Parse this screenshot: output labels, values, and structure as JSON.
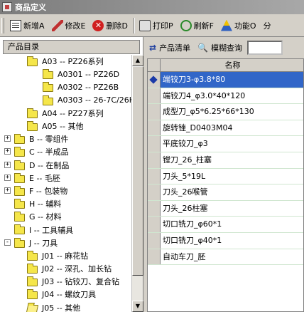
{
  "window": {
    "title": "商品定义"
  },
  "toolbar": {
    "buttons": [
      {
        "label": "新增A",
        "icon": "new-doc-icon"
      },
      {
        "label": "修改E",
        "icon": "edit-icon"
      },
      {
        "label": "删除D",
        "icon": "delete-icon"
      },
      {
        "label": "打印P",
        "icon": "print-icon"
      },
      {
        "label": "刷新F",
        "icon": "refresh-icon"
      },
      {
        "label": "功能O",
        "icon": "function-icon"
      },
      {
        "label": "分",
        "icon": ""
      }
    ]
  },
  "left_panel": {
    "header": "产品目录",
    "tree": [
      {
        "label": "A03 -- PZ26系列",
        "level": 1,
        "expander": "",
        "open": false
      },
      {
        "label": "A0301 -- PZ26D",
        "level": 2,
        "expander": "",
        "open": false
      },
      {
        "label": "A0302 -- PZ26B",
        "level": 2,
        "expander": "",
        "open": false
      },
      {
        "label": "A0303 -- 26-7C/26H",
        "level": 2,
        "expander": "",
        "open": false
      },
      {
        "label": "A04 -- PZ27系列",
        "level": 1,
        "expander": "",
        "open": false
      },
      {
        "label": "A05 -- 其他",
        "level": 1,
        "expander": "",
        "open": false
      },
      {
        "label": "B -- 零组件",
        "level": 0,
        "expander": "+",
        "open": false
      },
      {
        "label": "C -- 半成品",
        "level": 0,
        "expander": "+",
        "open": false
      },
      {
        "label": "D -- 在制品",
        "level": 0,
        "expander": "+",
        "open": false
      },
      {
        "label": "E -- 毛胚",
        "level": 0,
        "expander": "+",
        "open": false
      },
      {
        "label": "F -- 包装物",
        "level": 0,
        "expander": "+",
        "open": false
      },
      {
        "label": "H -- 辅料",
        "level": 0,
        "expander": "",
        "open": false
      },
      {
        "label": "G -- 材料",
        "level": 0,
        "expander": "",
        "open": false
      },
      {
        "label": "I -- 工具辅具",
        "level": 0,
        "expander": "",
        "open": false
      },
      {
        "label": "J -- 刀具",
        "level": 0,
        "expander": "-",
        "open": false
      },
      {
        "label": "J01 -- 麻花钻",
        "level": 1,
        "expander": "",
        "open": false
      },
      {
        "label": "J02 -- 深孔、加长钻",
        "level": 1,
        "expander": "",
        "open": false
      },
      {
        "label": "J03 -- 钻铰刀、复合钻",
        "level": 1,
        "expander": "",
        "open": false
      },
      {
        "label": "J04 -- 螺纹刀具",
        "level": 1,
        "expander": "",
        "open": false
      },
      {
        "label": "J05 -- 其他",
        "level": 1,
        "expander": "",
        "open": true
      }
    ]
  },
  "right_panel": {
    "toolbar": {
      "list_label": "产品清单",
      "search_label": "模糊查询",
      "search_value": ""
    },
    "grid": {
      "column_header": "名称",
      "selected_index": 0,
      "rows": [
        "端铰刀3-φ3.8*80",
        "端铰刀4_φ3.0*40*120",
        "成型刀_φ5*6.25*66*130",
        "旋转锉_D0403M04",
        "平底铰刀_φ3",
        "镗刀_26_柱塞",
        "刀头_5*19L",
        "刀头_26喉管",
        "刀头_26柱塞",
        "切口铣刀_φ60*1",
        "切口铣刀_φ40*1",
        "自动车刀_胚"
      ]
    }
  }
}
